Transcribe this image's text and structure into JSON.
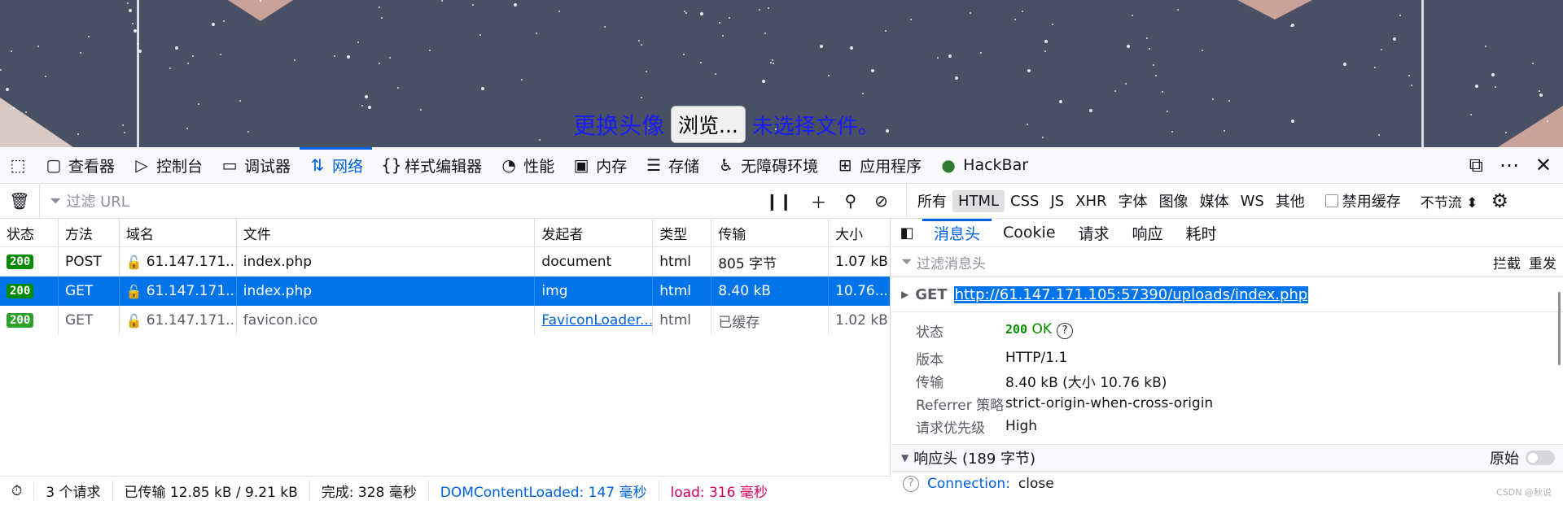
{
  "page": {
    "label": "更换头像",
    "browse_button": "浏览...",
    "no_file": "未选择文件。"
  },
  "toolbox": {
    "tabs": [
      {
        "icon": "inspector-icon",
        "label": "查看器"
      },
      {
        "icon": "console-icon",
        "label": "控制台"
      },
      {
        "icon": "debugger-icon",
        "label": "调试器"
      },
      {
        "icon": "network-icon",
        "label": "网络"
      },
      {
        "icon": "style-editor-icon",
        "label": "样式编辑器"
      },
      {
        "icon": "performance-icon",
        "label": "性能"
      },
      {
        "icon": "memory-icon",
        "label": "内存"
      },
      {
        "icon": "storage-icon",
        "label": "存储"
      },
      {
        "icon": "accessibility-icon",
        "label": "无障碍环境"
      },
      {
        "icon": "application-icon",
        "label": "应用程序"
      },
      {
        "icon": "hackbar-icon",
        "label": "HackBar"
      }
    ],
    "active_tab": "网络"
  },
  "filter": {
    "placeholder": "过滤 URL",
    "types": [
      "所有",
      "HTML",
      "CSS",
      "JS",
      "XHR",
      "字体",
      "图像",
      "媒体",
      "WS",
      "其他"
    ],
    "active_type": "HTML",
    "disable_cache": "禁用缓存",
    "throttle": "不节流 ⬍"
  },
  "table": {
    "headers": [
      "状态",
      "方法",
      "域名",
      "文件",
      "发起者",
      "类型",
      "传输",
      "大小"
    ],
    "rows": [
      {
        "status": "200",
        "method": "POST",
        "domain": "61.147.171....",
        "file": "index.php",
        "initiator": "document",
        "type": "html",
        "transfer": "805 字节",
        "size": "1.07 kB"
      },
      {
        "status": "200",
        "method": "GET",
        "domain": "61.147.171....",
        "file": "index.php",
        "initiator": "img",
        "type": "html",
        "transfer": "8.40 kB",
        "size": "10.76..."
      },
      {
        "status": "200",
        "method": "GET",
        "domain": "61.147.171....",
        "file": "favicon.ico",
        "initiator": "FaviconLoader....",
        "type": "html",
        "transfer": "已缓存",
        "size": "1.02 kB"
      }
    ]
  },
  "statusbar": {
    "requests": "3 个请求",
    "transferred": "已传输 12.85 kB / 9.21 kB",
    "finish": "完成: 328 毫秒",
    "dom": "DOMContentLoaded: 147 毫秒",
    "load": "load: 316 毫秒"
  },
  "details": {
    "tabs": [
      "消息头",
      "Cookie",
      "请求",
      "响应",
      "耗时"
    ],
    "active_tab": "消息头",
    "filter_placeholder": "过滤消息头",
    "block": "拦截",
    "resend": "重发",
    "method": "GET",
    "url": "http://61.147.171.105:57390/uploads/index.php",
    "fields": [
      {
        "key": "状态",
        "value": "OK"
      },
      {
        "key": "版本",
        "value": "HTTP/1.1"
      },
      {
        "key": "传输",
        "value": "8.40 kB (大小 10.76 kB)"
      },
      {
        "key": "Referrer 策略",
        "value": "strict-origin-when-cross-origin"
      },
      {
        "key": "请求优先级",
        "value": "High"
      }
    ],
    "status_code": "200",
    "response_headers": "响应头 (189 字节)",
    "raw": "原始",
    "conn_key": "Connection:",
    "conn_val": "close"
  },
  "watermark": "CSDN @秋说"
}
